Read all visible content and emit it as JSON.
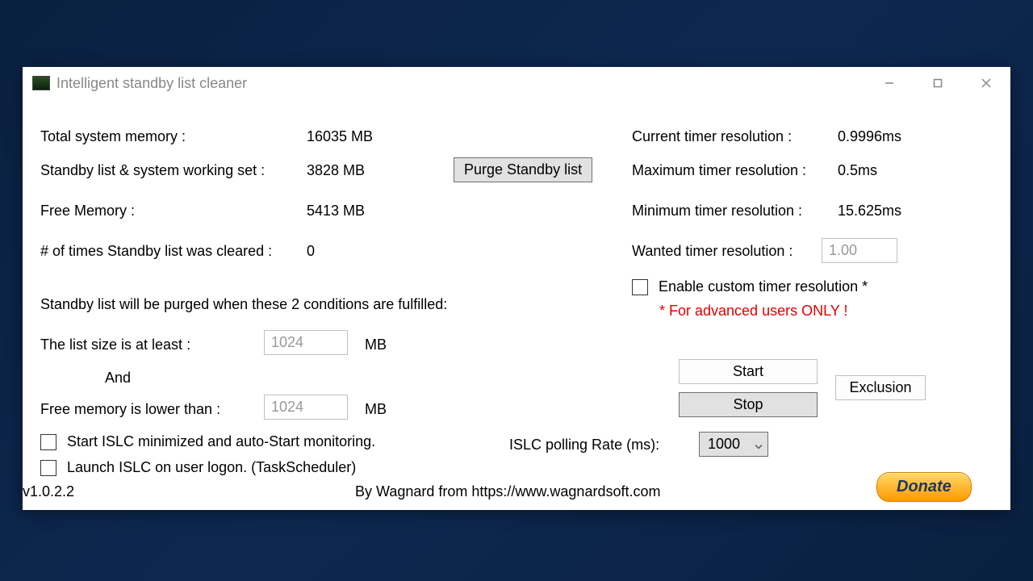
{
  "window": {
    "title": "Intelligent standby list cleaner"
  },
  "memory": {
    "total_label": "Total system memory :",
    "total_value": "16035 MB",
    "standby_label": "Standby list & system working set :",
    "standby_value": "3828 MB",
    "free_label": "Free Memory :",
    "free_value": "5413 MB",
    "cleared_label": "# of times Standby list was cleared :",
    "cleared_value": "0"
  },
  "purge_btn": "Purge Standby list",
  "timer": {
    "current_label": "Current timer resolution :",
    "current_value": "0.9996ms",
    "max_label": "Maximum timer resolution :",
    "max_value": "0.5ms",
    "min_label": "Minimum timer resolution :",
    "min_value": "15.625ms",
    "wanted_label": "Wanted timer resolution :",
    "wanted_value": "1.00",
    "enable_label": "Enable custom timer resolution *",
    "warning": "* For advanced users ONLY !"
  },
  "conditions": {
    "header": "Standby list will be purged when these 2 conditions are fulfilled:",
    "size_label": "The list size is at least :",
    "size_value": "1024",
    "size_unit": "MB",
    "and": "And",
    "free_label": "Free memory is lower than :",
    "free_value": "1024",
    "free_unit": "MB"
  },
  "options": {
    "start_min": "Start ISLC minimized and auto-Start monitoring.",
    "launch_logon": "Launch ISLC on user logon. (TaskScheduler)"
  },
  "polling": {
    "label": "ISLC polling Rate (ms):",
    "value": "1000"
  },
  "buttons": {
    "start": "Start",
    "stop": "Stop",
    "exclusion": "Exclusion",
    "donate": "Donate"
  },
  "footer": {
    "version": "v1.0.2.2",
    "credit": "By Wagnard from https://www.wagnardsoft.com"
  }
}
